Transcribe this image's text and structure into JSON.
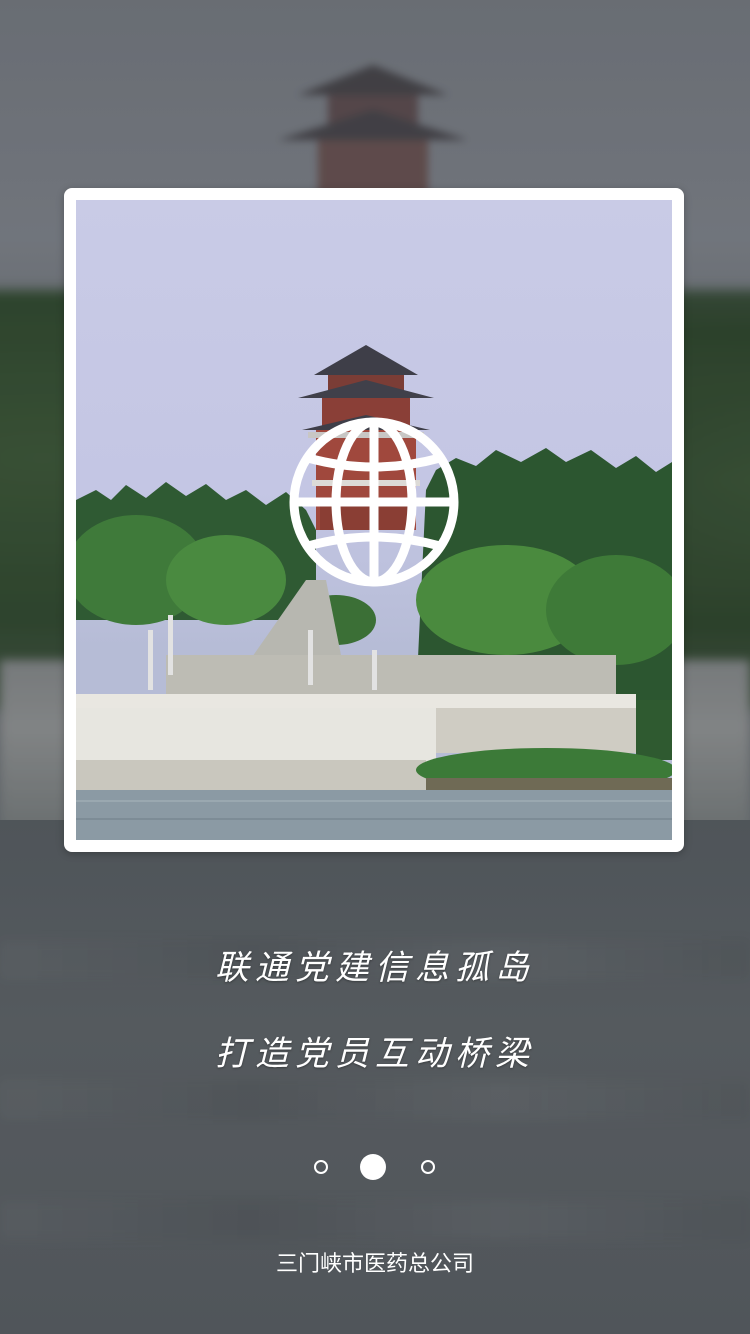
{
  "slides": {
    "headline_line1": "联通党建信息孤岛",
    "headline_line2": "打造党员互动桥梁",
    "total": 3,
    "active_index": 1
  },
  "footer": {
    "company": "三门峡市医药总公司"
  },
  "icons": {
    "center_icon": "globe-icon"
  },
  "colors": {
    "text": "#ffffff",
    "frame": "#ffffff"
  }
}
